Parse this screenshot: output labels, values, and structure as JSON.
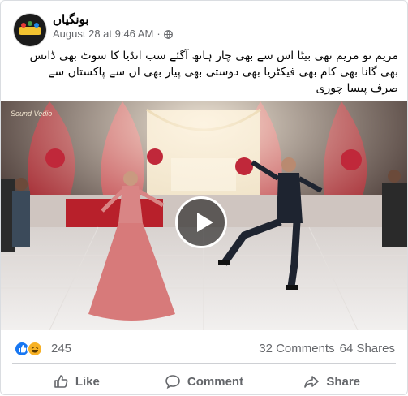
{
  "post": {
    "page_name": "بونگیاں",
    "date": "August 28 at 9:46 AM",
    "separator": "·",
    "privacy_icon": "globe-icon",
    "text_lines": [
      "مریم تو مریم تھی بیٹا اس سے بھی چار ہاتھ آگئے سب انڈیا کا سوٹ بھی ڈانس",
      "بھی گانا بھی کام بھی فیکٹریا بھی دوستی بھی پیار بھی ان سے پاکستان سے",
      "صرف پیسا چوری"
    ]
  },
  "video": {
    "watermark": "Sound Vedio",
    "play_icon": "play-icon"
  },
  "stats": {
    "reactions_count": "245",
    "comments": "32 Comments",
    "shares": "64 Shares"
  },
  "actions": {
    "like": "Like",
    "comment": "Comment",
    "share": "Share"
  },
  "colors": {
    "facebook_blue": "#1877f2",
    "meta_gray": "#65676b",
    "haha_yellow": "#f7b125"
  }
}
